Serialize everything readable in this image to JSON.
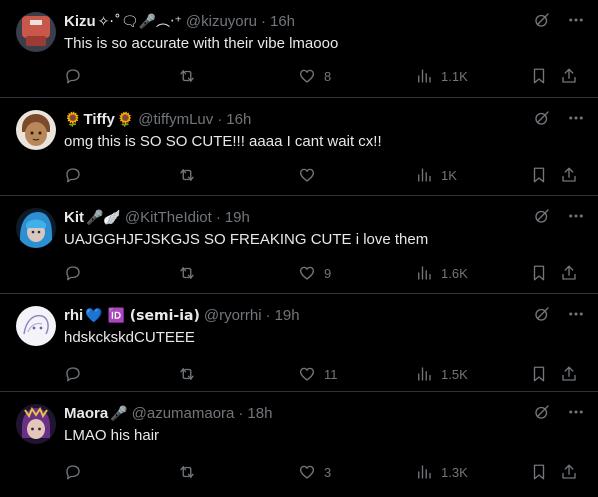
{
  "replies": [
    {
      "display_name": "Kizu",
      "name_suffix": "✧·˚🗨🎤︵‧⁺",
      "handle": "@kizuyoru",
      "time": "16h",
      "text": "This is so accurate with their vibe lmaooo",
      "reply_count": "",
      "repost_count": "",
      "like_count": "8",
      "view_count": "1.1K",
      "avatar": "red-chair-avatar"
    },
    {
      "display_name": "Tiffy",
      "name_prefix": "🌻",
      "name_suffix": "🌻",
      "handle": "@tiffymLuv",
      "time": "16h",
      "text": "omg this is SO SO CUTE!!! aaaa I cant wait cx!!",
      "reply_count": "",
      "repost_count": "",
      "like_count": "",
      "view_count": "1K",
      "avatar": "drawn-face-avatar"
    },
    {
      "display_name": "Kit",
      "name_suffix": "🎤🪽",
      "handle": "@KitTheIdiot",
      "time": "19h",
      "text": "UAJGGHJFJSKGJS SO FREAKING CUTE i love them",
      "reply_count": "",
      "repost_count": "",
      "like_count": "9",
      "view_count": "1.6K",
      "avatar": "blue-hair-avatar"
    },
    {
      "display_name": "rhi",
      "name_suffix": "💙 🆔 (semi-ia)",
      "handle": "@ryorrhi",
      "time": "19h",
      "text": "hdskckskdCUTEEE",
      "reply_count": "",
      "repost_count": "",
      "like_count": "11",
      "view_count": "1.5K",
      "avatar": "sketch-avatar"
    },
    {
      "display_name": "Maora",
      "name_suffix": "🎤",
      "handle": "@azumamaora",
      "time": "18h",
      "text": "LMAO his hair",
      "reply_count": "",
      "repost_count": "",
      "like_count": "3",
      "view_count": "1.3K",
      "avatar": "purple-hair-avatar"
    }
  ],
  "separator": "·",
  "colors": {
    "background": "#000000",
    "text": "#e7e9ea",
    "muted": "#71767b",
    "border": "#2f3336"
  },
  "icons": {
    "grok": "grok-icon",
    "more": "more-icon",
    "reply": "reply-icon",
    "repost": "repost-icon",
    "like": "heart-icon",
    "views": "views-icon",
    "bookmark": "bookmark-icon",
    "share": "share-icon"
  }
}
